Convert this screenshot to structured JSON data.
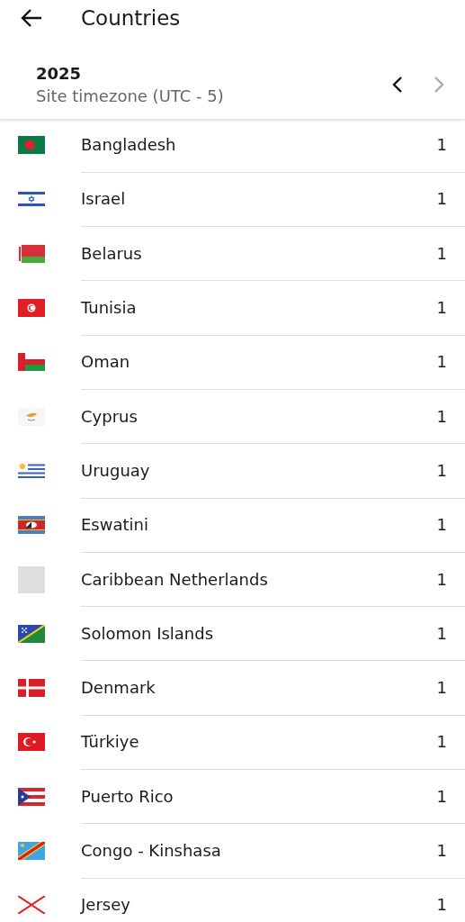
{
  "app_bar": {
    "title": "Countries"
  },
  "period": {
    "year": "2025",
    "timezone": "Site timezone (UTC - 5)",
    "nav": [
      {
        "kind": "previous",
        "disabled": false
      },
      {
        "kind": "next",
        "disabled": true
      }
    ]
  },
  "countries": [
    {
      "name": "Bangladesh",
      "count": "1",
      "kind": "flag"
    },
    {
      "name": "Israel",
      "count": "1",
      "kind": "flag"
    },
    {
      "name": "Belarus",
      "count": "1",
      "kind": "flag"
    },
    {
      "name": "Tunisia",
      "count": "1",
      "kind": "flag"
    },
    {
      "name": "Oman",
      "count": "1",
      "kind": "flag"
    },
    {
      "name": "Cyprus",
      "count": "1",
      "kind": "flag"
    },
    {
      "name": "Uruguay",
      "count": "1",
      "kind": "flag"
    },
    {
      "name": "Eswatini",
      "count": "1",
      "kind": "flag"
    },
    {
      "name": "Caribbean Netherlands",
      "count": "1",
      "kind": "placeholder"
    },
    {
      "name": "Solomon Islands",
      "count": "1",
      "kind": "flag"
    },
    {
      "name": "Denmark",
      "count": "1",
      "kind": "flag"
    },
    {
      "name": "Türkiye",
      "count": "1",
      "kind": "flag"
    },
    {
      "name": "Puerto Rico",
      "count": "1",
      "kind": "flag"
    },
    {
      "name": "Congo - Kinshasa",
      "count": "1",
      "kind": "flag"
    },
    {
      "name": "Jersey",
      "count": "1",
      "kind": "flag"
    }
  ]
}
